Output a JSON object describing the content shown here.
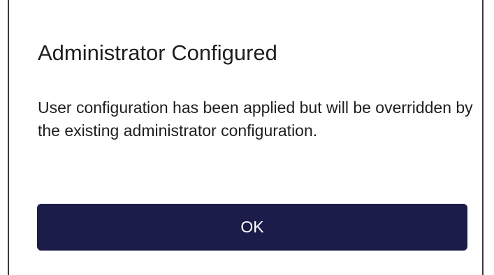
{
  "dialog": {
    "title": "Administrator Configured",
    "message": "User configuration has been applied but will be overridden by the existing administrator configuration.",
    "ok_label": "OK"
  },
  "colors": {
    "button_background": "#1c1c4b",
    "button_text": "#ffffff",
    "text": "#1e1e1e",
    "border": "#3a3a3a"
  }
}
